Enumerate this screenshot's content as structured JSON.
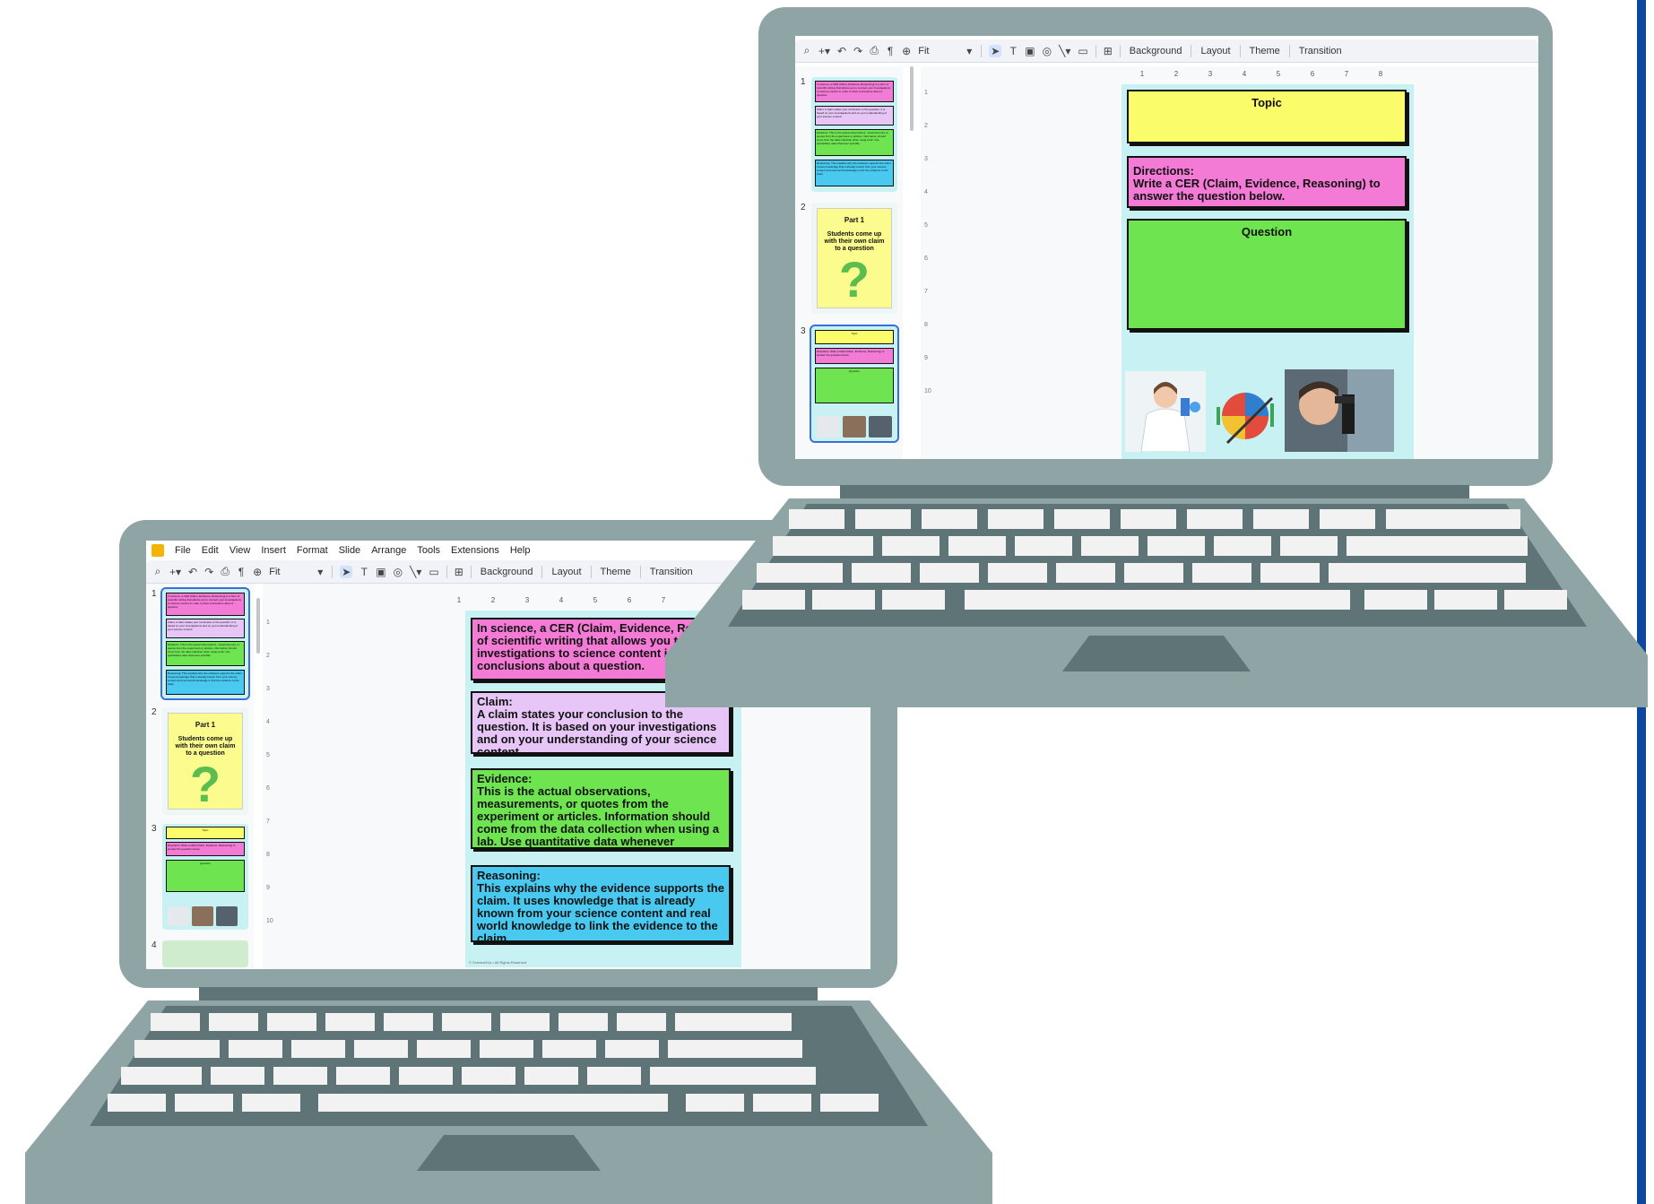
{
  "app": {
    "menu": [
      "File",
      "Edit",
      "View",
      "Insert",
      "Format",
      "Slide",
      "Arrange",
      "Tools",
      "Extensions",
      "Help"
    ],
    "zoom": "Fit",
    "toolbar_buttons": [
      "Background",
      "Layout",
      "Theme",
      "Transition"
    ],
    "icons": [
      "search-icon",
      "add-icon",
      "undo-icon",
      "redo-icon",
      "print-icon",
      "paint-format-icon",
      "zoom-icon",
      "select-icon",
      "text-box-icon",
      "image-icon",
      "shape-icon",
      "line-icon",
      "video-icon",
      "comment-icon"
    ]
  },
  "ruler": {
    "top": [
      "1",
      "2",
      "3",
      "4",
      "5",
      "6",
      "7",
      "8"
    ],
    "left": [
      "1",
      "2",
      "3",
      "4",
      "5",
      "6",
      "7",
      "8",
      "9",
      "10"
    ]
  },
  "slides": {
    "numbers": [
      "1",
      "2",
      "3",
      "4"
    ],
    "slide1": {
      "intro": "In science, a CER (Claim, Evidence, Reasoning) is a form of scientific writing that allows you to connect your investigations to science content in order to draw conclusions about a question.",
      "intro_visible": "In science, a CER (Claim, Evidence, Reason form of scientific writing that allows you t your investigations to science content i draw conclusions about a question.",
      "claim": "Claim:\nA claim states your conclusion to the question.  It is based on your investigations and on your understanding of your science content.",
      "evidence": "Evidence:\nThis is the actual observations, measurements, or quotes from the experiment or articles. Information should come from the data collection when using a lab. Use quantitative data whenever possible.",
      "reasoning": "Reasoning:\nThis explains why the evidence supports the claim.  It uses knowledge that is already known from your science content and real world knowledge to link the evidence to the claim.",
      "footer": "© Science4Us • All Rights Reserved"
    },
    "slide2": {
      "title": "Part 1",
      "text": "Students come up with their own claim to a question",
      "mark": "?"
    },
    "slide3": {
      "topic": "Topic",
      "directions": "Directions:\nWrite a CER (Claim, Evidence, Reasoning) to answer the question below.",
      "question": "Question"
    }
  },
  "colors": {
    "laptop_body": "#8ea4a5",
    "laptop_dark": "#5f7476",
    "key": "#f2f2f2",
    "yellow": "#fbfc6a",
    "pink": "#f37ad5",
    "lilac": "#e7c6f7",
    "green": "#6ee550",
    "blue": "#49c9f0",
    "slide_bg": "#c8f1f4",
    "accent_bar": "#0d47a1"
  }
}
